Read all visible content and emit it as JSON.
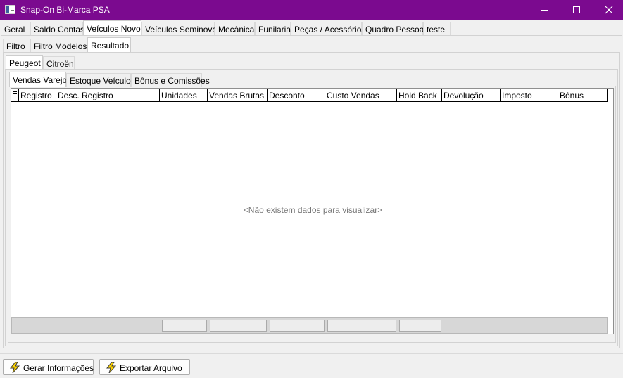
{
  "window": {
    "title": "Snap-On Bi-Marca PSA"
  },
  "main_tabs": [
    {
      "label": "Geral"
    },
    {
      "label": "Saldo Contas"
    },
    {
      "label": "Veículos Novos"
    },
    {
      "label": "Veículos Seminovos"
    },
    {
      "label": "Mecânica"
    },
    {
      "label": "Funilaria"
    },
    {
      "label": "Peças / Acessórios"
    },
    {
      "label": "Quadro Pessoal"
    },
    {
      "label": "teste"
    }
  ],
  "sub_tabs": [
    {
      "label": "Filtro"
    },
    {
      "label": "Filtro Modelos"
    },
    {
      "label": "Resultado"
    }
  ],
  "brand_tabs": [
    {
      "label": "Peugeot"
    },
    {
      "label": "Citroën"
    }
  ],
  "report_tabs": [
    {
      "label": "Vendas Varejo"
    },
    {
      "label": "Estoque Veículos"
    },
    {
      "label": "Bônus e Comissões"
    }
  ],
  "grid": {
    "columns": [
      "Registro",
      "Desc. Registro",
      "Unidades",
      "Vendas Brutas",
      "Desconto",
      "Custo Vendas",
      "Hold Back",
      "Devolução",
      "Imposto",
      "Bônus"
    ],
    "empty_message": "<Não existem dados para visualizar>"
  },
  "actions": {
    "gerar_label": "Gerar Informações",
    "exportar_label": "Exportar Arquivo",
    "icon": "lightning-icon",
    "icon_color": "#e6b800"
  },
  "colors": {
    "titlebar": "#7b0a8f"
  }
}
